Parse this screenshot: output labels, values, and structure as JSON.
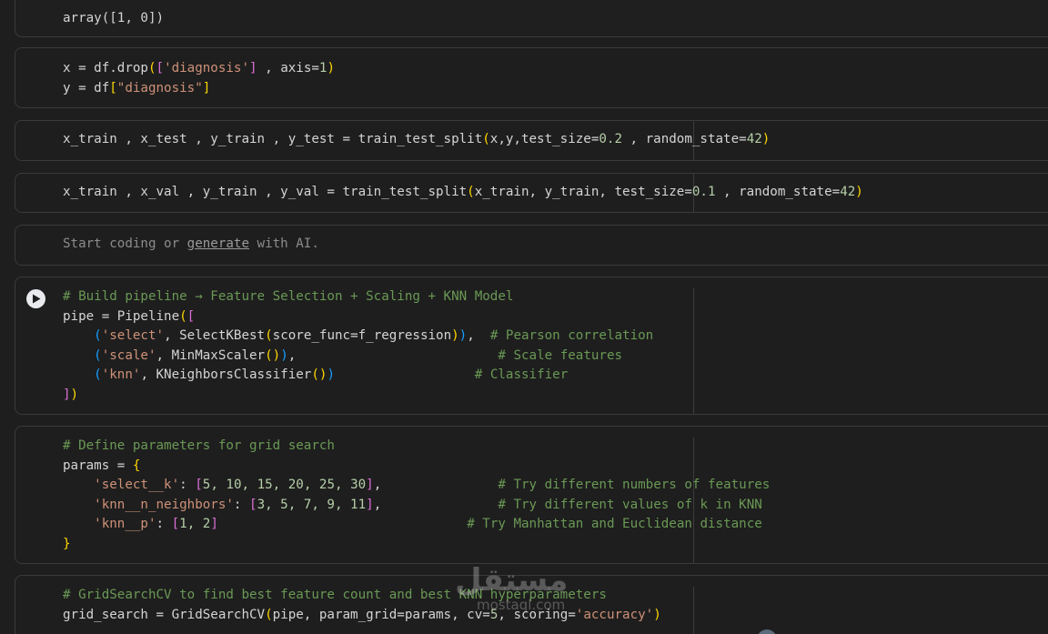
{
  "cells": {
    "output_array": "array([1, 0])",
    "xy": {
      "x_prefix": "x = df.drop",
      "x_col": "'diagnosis'",
      "x_mid": " , axis=",
      "x_axis": "1",
      "y_prefix": "y = df",
      "y_col": "\"diagnosis\""
    },
    "split1": {
      "prefix": "x_train , x_test , y_train , y_test = train_test_split",
      "args": "x,y,test_size=",
      "size": "0.2",
      "mid": " , random_state=",
      "seed": "42"
    },
    "split2": {
      "prefix": "x_train , x_val , y_train , y_val = train_test_split",
      "args": "x_train, y_train, test_size=",
      "size": "0.1",
      "mid": " , random_state=",
      "seed": "42"
    },
    "placeholder": {
      "start": "Start coding or ",
      "link": "generate",
      "end": " with AI."
    },
    "pipeline": {
      "comment": "# Build pipeline → Feature Selection + Scaling + KNN Model",
      "pipe_prefix": "pipe = Pipeline",
      "select_str": "'select'",
      "select_fn": ", SelectKBest",
      "select_args": "score_func=f_regression",
      "select_comment": "# Pearson correlation",
      "scale_str": "'scale'",
      "scale_fn": ", MinMaxScaler",
      "scale_comment": "# Scale features",
      "knn_str": "'knn'",
      "knn_fn": ", KNeighborsClassifier",
      "knn_comment": "# Classifier"
    },
    "params": {
      "comment": "# Define parameters for grid search",
      "params_prefix": "params = ",
      "k_key": "'select__k'",
      "k_vals": "5, 10, 15, 20, 25, 30",
      "k_comment": "# Try different numbers of features",
      "nn_key": "'knn__n_neighbors'",
      "nn_vals": "3, 5, 7, 9, 11",
      "nn_comment": "# Try different values of k in KNN",
      "p_key": "'knn__p'",
      "p_vals": "1, 2",
      "p_comment": "# Try Manhattan and Euclidean distance"
    },
    "grid": {
      "comment": "# GridSearchCV to find best feature count and best KNN hyperparameters",
      "prefix": "grid_search = GridSearchCV",
      "args": "pipe, param_grid=params, cv=",
      "cv": "5",
      "mid": ", scoring=",
      "scoring": "'accuracy'"
    }
  },
  "watermark": {
    "main": "مستقل",
    "sub": "mostaql.com"
  },
  "icons": {
    "run": "play-icon"
  }
}
